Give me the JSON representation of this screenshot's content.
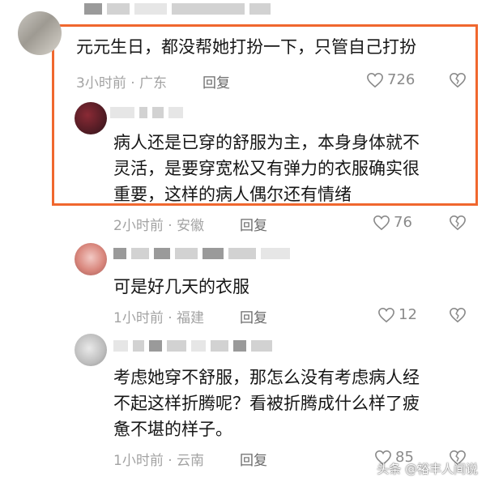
{
  "comments": [
    {
      "text_lines": [
        "元元生日，都没帮她打扮一下，只管自己打扮"
      ],
      "meta": "3小时前 · 广东",
      "reply_label": "回复",
      "likes": "726"
    },
    {
      "text_lines": [
        "病人还是已穿的舒服为主，本身身体就不",
        "灵活，是要穿宽松又有弹力的衣服确实很",
        "重要，这样的病人偶尔还有情绪"
      ],
      "meta": "2小时前 · 安徽",
      "reply_label": "回复",
      "likes": "76"
    },
    {
      "text_lines": [
        "可是好几天的衣服"
      ],
      "meta": "1小时前 · 福建",
      "reply_label": "回复",
      "likes": "12"
    },
    {
      "text_lines": [
        "考虑她穿不舒服，那怎么没有考虑病人经",
        "不起这样折腾呢？看被折腾成什么样了疲",
        "惫不堪的样子。"
      ],
      "meta": "1小时前 · 云南",
      "reply_label": "回复",
      "likes": "85"
    }
  ],
  "watermark": "头条 @裕丰人间说",
  "colors": {
    "highlight": "#f0672e",
    "meta": "#a3a3a3",
    "text": "#161616"
  },
  "icons": [
    "heart-icon",
    "broken-heart-icon"
  ]
}
